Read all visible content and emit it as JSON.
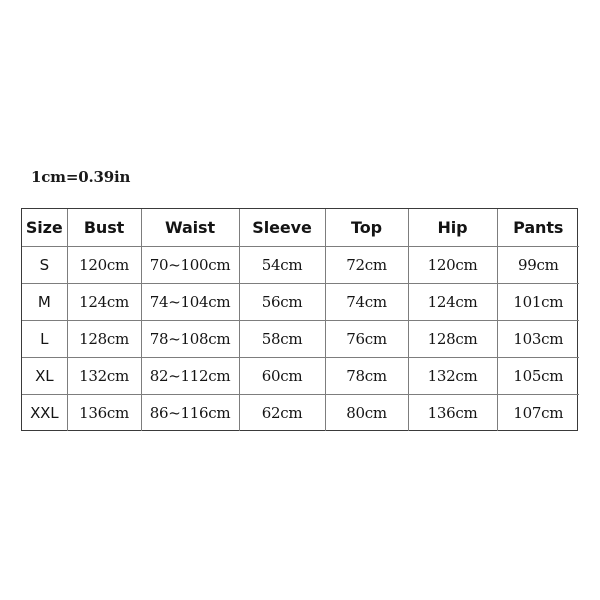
{
  "page": {
    "background_color": "#ffffff",
    "unit_note": "1cm=0.39in"
  },
  "size_table": {
    "border_color_outer": "#3a3a3a",
    "border_color_inner": "#7d7d7d",
    "text_color": "#141414",
    "columns": [
      "Size",
      "Bust",
      "Waist",
      "Sleeve",
      "Top",
      "Hip",
      "Pants"
    ],
    "rows": [
      {
        "size": "S",
        "bust": "120cm",
        "waist": "70~100cm",
        "sleeve": "54cm",
        "top": "72cm",
        "hip": "120cm",
        "pants": "99cm"
      },
      {
        "size": "M",
        "bust": "124cm",
        "waist": "74~104cm",
        "sleeve": "56cm",
        "top": "74cm",
        "hip": "124cm",
        "pants": "101cm"
      },
      {
        "size": "L",
        "bust": "128cm",
        "waist": "78~108cm",
        "sleeve": "58cm",
        "top": "76cm",
        "hip": "128cm",
        "pants": "103cm"
      },
      {
        "size": "XL",
        "bust": "132cm",
        "waist": "82~112cm",
        "sleeve": "60cm",
        "top": "78cm",
        "hip": "132cm",
        "pants": "105cm"
      },
      {
        "size": "XXL",
        "bust": "136cm",
        "waist": "86~116cm",
        "sleeve": "62cm",
        "top": "80cm",
        "hip": "136cm",
        "pants": "107cm"
      }
    ]
  }
}
